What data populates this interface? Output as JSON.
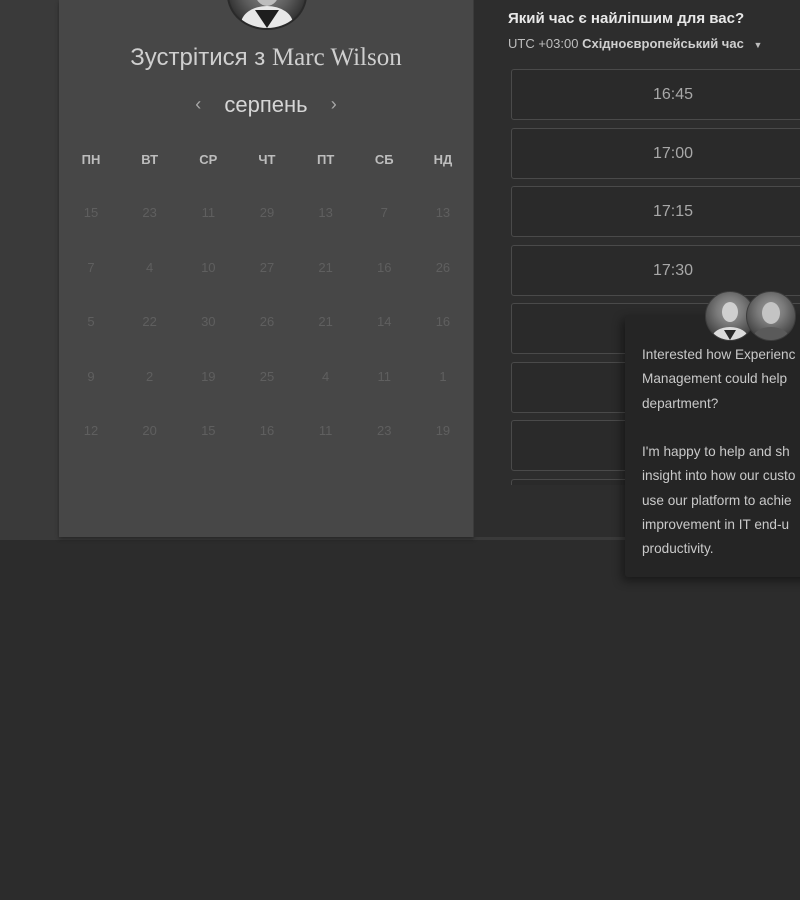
{
  "calendar": {
    "title_prefix": "Зустрітися з",
    "host_name": "Marc Wilson",
    "month": "серпень",
    "prev_arrow": "‹",
    "next_arrow": "›",
    "weekdays": [
      "ПН",
      "ВТ",
      "СР",
      "ЧТ",
      "ПТ",
      "СБ",
      "НД"
    ],
    "weeks": [
      [
        "15",
        "23",
        "11",
        "29",
        "13",
        "7",
        "13"
      ],
      [
        "7",
        "4",
        "10",
        "27",
        "21",
        "16",
        "26"
      ],
      [
        "5",
        "22",
        "30",
        "26",
        "21",
        "14",
        "16"
      ],
      [
        "9",
        "2",
        "19",
        "25",
        "4",
        "11",
        "1"
      ],
      [
        "12",
        "20",
        "15",
        "16",
        "11",
        "23",
        "19"
      ]
    ]
  },
  "times": {
    "question": "Який час є найліпшим для вас?",
    "timezone_offset": "UTC +03:00",
    "timezone_name": "Східноєвропейський час",
    "slots": [
      "16:45",
      "17:00",
      "17:15",
      "17:30",
      "",
      "",
      "",
      ""
    ]
  },
  "chat": {
    "paragraph1": [
      "Interested how Experienc",
      "Management could help",
      "department?"
    ],
    "paragraph2": [
      "I'm happy to help and sh",
      "insight into how our custo",
      "use our platform to achie",
      "improvement in IT end-u",
      "productivity."
    ]
  }
}
